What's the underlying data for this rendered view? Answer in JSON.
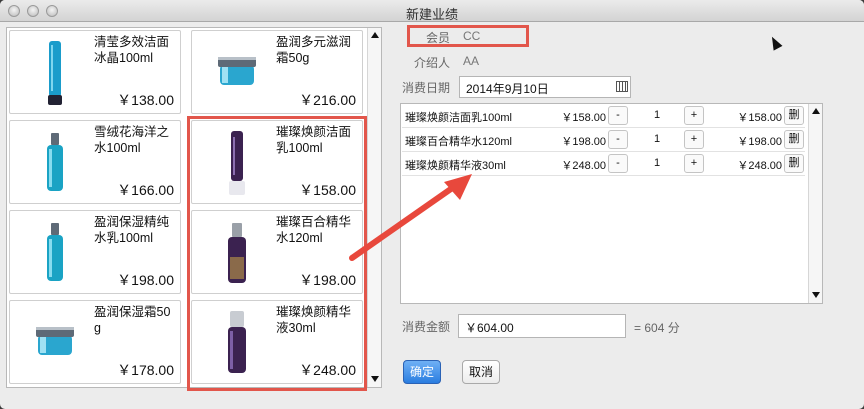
{
  "window": {
    "title": "新建业绩"
  },
  "products": [
    {
      "name": "清莹多效洁面冰晶100ml",
      "price": "￥138.00",
      "bottle": "tube-blue"
    },
    {
      "name": "盈润多元滋润霜50g",
      "price": "￥216.00",
      "bottle": "jar-blue"
    },
    {
      "name": "雪绒花海洋之水100ml",
      "price": "￥166.00",
      "bottle": "bottle-blue"
    },
    {
      "name": "璀璨焕颜洁面乳100ml",
      "price": "￥158.00",
      "bottle": "tube-purple"
    },
    {
      "name": "盈润保湿精纯水乳100ml",
      "price": "￥198.00",
      "bottle": "bottle-blue"
    },
    {
      "name": "璀璨百合精华水120ml",
      "price": "￥198.00",
      "bottle": "bottle-purple"
    },
    {
      "name": "盈润保湿霜50g",
      "price": "￥178.00",
      "bottle": "jar-blue"
    },
    {
      "name": "璀璨焕颜精华液30ml",
      "price": "￥248.00",
      "bottle": "pump-purple"
    }
  ],
  "form": {
    "member_label": "会员",
    "member_value": "CC",
    "referrer_label": "介绍人",
    "referrer_value": "AA",
    "date_label": "消费日期",
    "date_value": "2014年9月10日",
    "amount_label": "消费金额",
    "amount_value": "￥604.00",
    "points_text": "= 604 分"
  },
  "order": {
    "minus_label": "-",
    "plus_label": "+",
    "delete_label": "删",
    "rows": [
      {
        "name": "璀璨焕颜洁面乳100ml",
        "price": "￥158.00",
        "qty": "1",
        "total": "￥158.00"
      },
      {
        "name": "璀璨百合精华水120ml",
        "price": "￥198.00",
        "qty": "1",
        "total": "￥198.00"
      },
      {
        "name": "璀璨焕颜精华液30ml",
        "price": "￥248.00",
        "qty": "1",
        "total": "￥248.00"
      }
    ]
  },
  "buttons": {
    "confirm": "确定",
    "cancel": "取消"
  },
  "colors": {
    "highlight": "#e2564b",
    "primary": "#2a7de0",
    "tealBottle": "#1aa3c4",
    "purpleBottle": "#3b2250"
  }
}
